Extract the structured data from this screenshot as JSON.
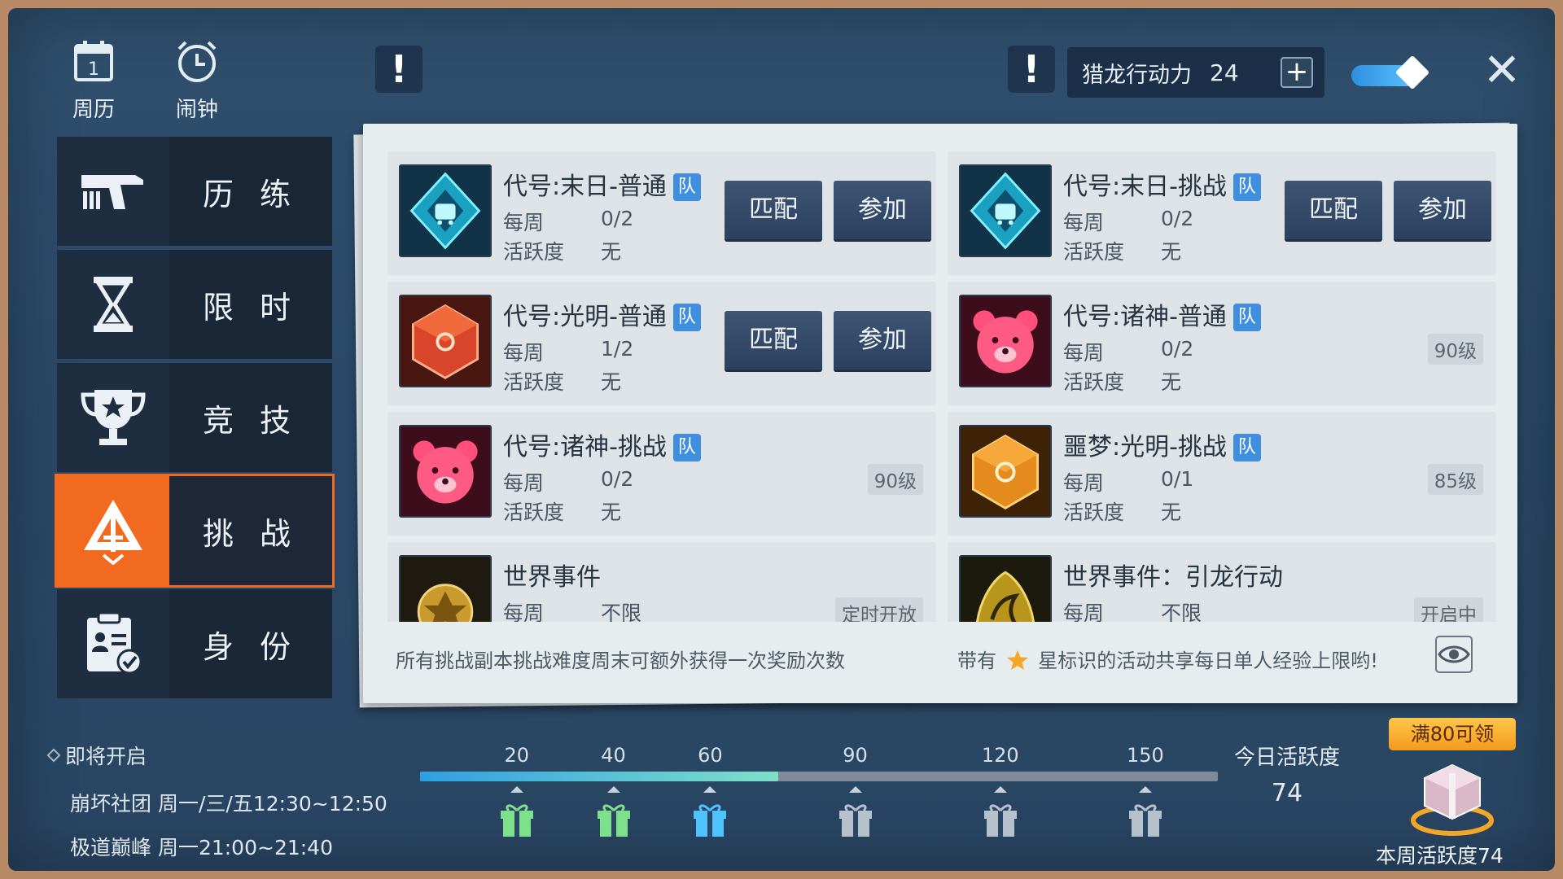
{
  "top": {
    "calendar_label": "周历",
    "calendar_day": "1",
    "alarm_label": "闹钟",
    "alert_1": "!",
    "alert_2": "!",
    "stamina_label": "猎龙行动力",
    "stamina_value": "24",
    "plus": "+",
    "close": "✕"
  },
  "menu": [
    {
      "label": "历 练",
      "icon": "pistol-icon",
      "active": false
    },
    {
      "label": "限 时",
      "icon": "hourglass-icon",
      "active": false
    },
    {
      "label": "竞 技",
      "icon": "trophy-icon",
      "active": false
    },
    {
      "label": "挑 战",
      "icon": "challenge-sword-icon",
      "active": true
    },
    {
      "label": "身 份",
      "icon": "clipboard-check-icon",
      "active": false
    }
  ],
  "activities": [
    {
      "title": "代号:末日-普通",
      "team": "队",
      "weekly_label": "每周",
      "weekly": "0/2",
      "activity_label": "活跃度",
      "activity": "无",
      "match": "匹配",
      "join": "参加",
      "icon": "doomsday-crystal-icon"
    },
    {
      "title": "代号:末日-挑战",
      "team": "队",
      "weekly_label": "每周",
      "weekly": "0/2",
      "activity_label": "活跃度",
      "activity": "无",
      "match": "匹配",
      "join": "参加",
      "icon": "doomsday-crystal-icon"
    },
    {
      "title": "代号:光明-普通",
      "team": "队",
      "weekly_label": "每周",
      "weekly": "1/2",
      "activity_label": "活跃度",
      "activity": "无",
      "match": "匹配",
      "join": "参加",
      "icon": "light-cube-icon"
    },
    {
      "title": "代号:诸神-普通",
      "team": "队",
      "weekly_label": "每周",
      "weekly": "0/2",
      "activity_label": "活跃度",
      "activity": "无",
      "level": "90级",
      "icon": "bear-head-icon"
    },
    {
      "title": "代号:诸神-挑战",
      "team": "队",
      "weekly_label": "每周",
      "weekly": "0/2",
      "activity_label": "活跃度",
      "activity": "无",
      "level": "90级",
      "icon": "bear-head-icon"
    },
    {
      "title": "噩梦:光明-挑战",
      "team": "队",
      "weekly_label": "每周",
      "weekly": "0/1",
      "activity_label": "活跃度",
      "activity": "无",
      "level": "85级",
      "icon": "nightmare-cube-icon"
    },
    {
      "title": "世界事件",
      "weekly_label": "每周",
      "weekly": "不限",
      "level": "定时开放",
      "icon": "gold-emblem-icon"
    },
    {
      "title": "世界事件：引龙行动",
      "weekly_label": "每周",
      "weekly": "不限",
      "level": "开启中",
      "icon": "dragon-emblem-icon"
    }
  ],
  "footer": {
    "note_left": "所有挑战副本挑战难度周末可额外获得一次奖励次数",
    "note_right_1": "带有",
    "note_right_2": "星标识的活动共享每日单人经验上限哟!"
  },
  "upcoming": {
    "header": "即将开启",
    "line1": "崩坏社团 周一/三/五12:30~12:50",
    "line2": "极道巅峰 周一21:00~21:40"
  },
  "progress": {
    "milestones": [
      "20",
      "40",
      "60",
      "90",
      "120",
      "150"
    ],
    "current": 74,
    "max": 165,
    "today_label": "今日活跃度",
    "today_value": "74",
    "badge": "满80可领",
    "week_label": "本周活跃度74"
  },
  "colors": {
    "accent": "#f26a1f",
    "team_badge": "#3f8ee0",
    "button": "#33496a"
  }
}
